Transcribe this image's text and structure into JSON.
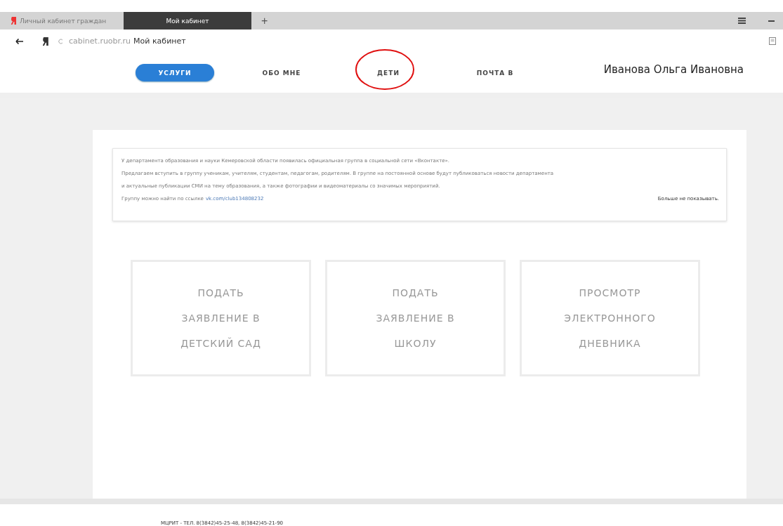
{
  "browser": {
    "tabs": [
      {
        "label": "Личный кабинет граждан",
        "selected": false
      },
      {
        "label": "Мой кабинет",
        "selected": true
      }
    ],
    "new_tab": "+",
    "address": {
      "host": "cabinet.ruobr.ru",
      "title": "Мой кабинет"
    }
  },
  "nav": {
    "items": [
      {
        "label": "УСЛУГИ",
        "selected": true,
        "circled": false
      },
      {
        "label": "ОБО МНЕ",
        "selected": false,
        "circled": false
      },
      {
        "label": "ДЕТИ",
        "selected": false,
        "circled": true
      },
      {
        "label": "ПОЧТА",
        "badge": "В",
        "selected": false,
        "circled": false
      }
    ],
    "user_name": "Иванова Ольга Ивановна"
  },
  "notice": {
    "lines": [
      "У департамента образования и науки Кемеровской области появилась официальная группа в социальной сети «Вконтакте».",
      "Предлагаем вступить в группу ученикам, учителям, студентам, педагогам, родителям. В группе на постоянной основе будут публиковаться новости департамента",
      "и актуальные публикации СМИ на тему образования, а также фотографии и видеоматериалы со значимых мероприятий."
    ],
    "link_prefix": "Группу можно найти по ссылке",
    "link": "vk.com/club134808232",
    "dismiss": "Больше не показывать."
  },
  "tiles": [
    {
      "lines": [
        "ПОДАТЬ",
        "ЗАЯВЛЕНИЕ В",
        "ДЕТСКИЙ САД"
      ]
    },
    {
      "lines": [
        "ПОДАТЬ",
        "ЗАЯВЛЕНИЕ В",
        "ШКОЛУ"
      ]
    },
    {
      "lines": [
        "ПРОСМОТР",
        "ЭЛЕКТРОННОГО",
        "ДНЕВНИКА"
      ]
    }
  ],
  "footer": "МЦРИТ - ТЕЛ. 8(3842)45-25-48, 8(3842)45-21-90"
}
